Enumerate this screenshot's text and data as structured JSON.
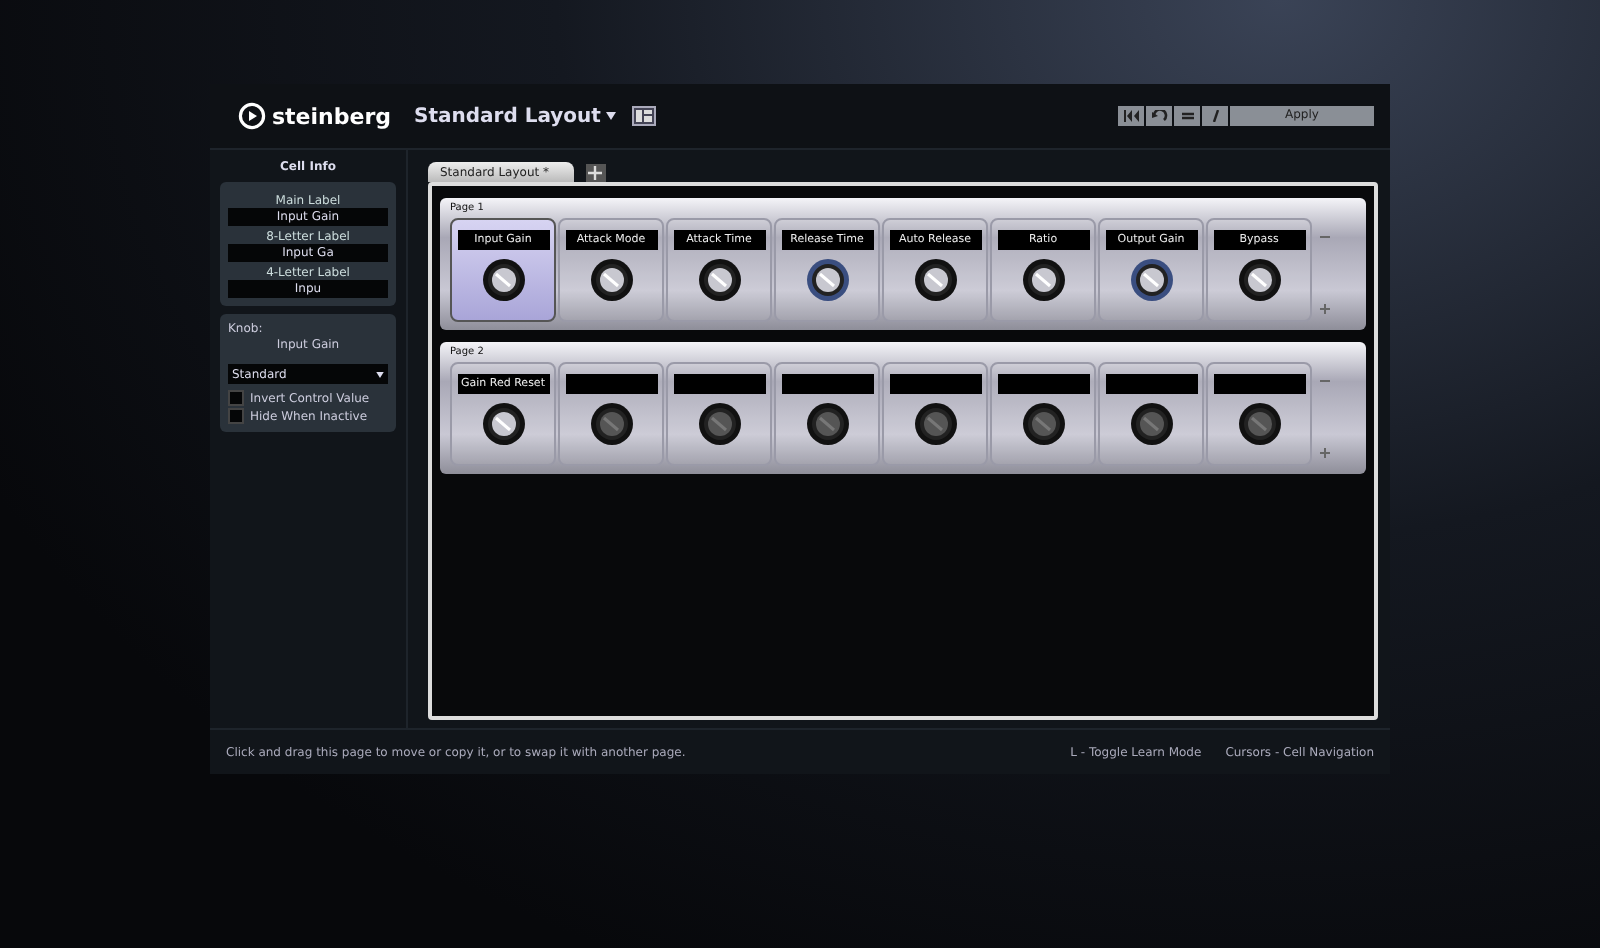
{
  "header": {
    "brand": "steinberg",
    "layout_title": "Standard Layout",
    "apply": "Apply"
  },
  "sidebar": {
    "title": "Cell Info",
    "fields": [
      {
        "label": "Main Label",
        "value": "Input Gain"
      },
      {
        "label": "8-Letter Label",
        "value": "Input Ga"
      },
      {
        "label": "4-Letter Label",
        "value": "Inpu"
      }
    ],
    "knob_label": "Knob:",
    "knob_name": "Input Gain",
    "mode": "Standard",
    "options": [
      {
        "label": "Invert Control Value",
        "checked": false
      },
      {
        "label": "Hide When Inactive",
        "checked": false
      }
    ]
  },
  "tabs": [
    {
      "label": "Standard Layout *",
      "selected": true
    }
  ],
  "pages": [
    {
      "title": "Page 1",
      "cells": [
        {
          "label": "Input Gain",
          "selected": true,
          "learned": false
        },
        {
          "label": "Attack Mode",
          "selected": false,
          "learned": false
        },
        {
          "label": "Attack Time",
          "selected": false,
          "learned": false
        },
        {
          "label": "Release Time",
          "selected": false,
          "learned": true
        },
        {
          "label": "Auto Release",
          "selected": false,
          "learned": false
        },
        {
          "label": "Ratio",
          "selected": false,
          "learned": false
        },
        {
          "label": "Output Gain",
          "selected": false,
          "learned": true
        },
        {
          "label": "Bypass",
          "selected": false,
          "learned": false
        }
      ]
    },
    {
      "title": "Page 2",
      "cells": [
        {
          "label": "Gain Red Reset",
          "selected": false,
          "learned": false
        },
        {
          "selected": false,
          "learned": false
        },
        {
          "selected": false,
          "learned": false
        },
        {
          "selected": false,
          "learned": false
        },
        {
          "selected": false,
          "learned": false
        },
        {
          "selected": false,
          "learned": false
        },
        {
          "selected": false,
          "learned": false
        },
        {
          "selected": false,
          "learned": false
        }
      ]
    }
  ],
  "status": {
    "hint": "Click and drag this page to move or copy it, or to swap it with another page.",
    "learn": "L - Toggle Learn Mode",
    "nav": "Cursors - Cell Navigation"
  }
}
